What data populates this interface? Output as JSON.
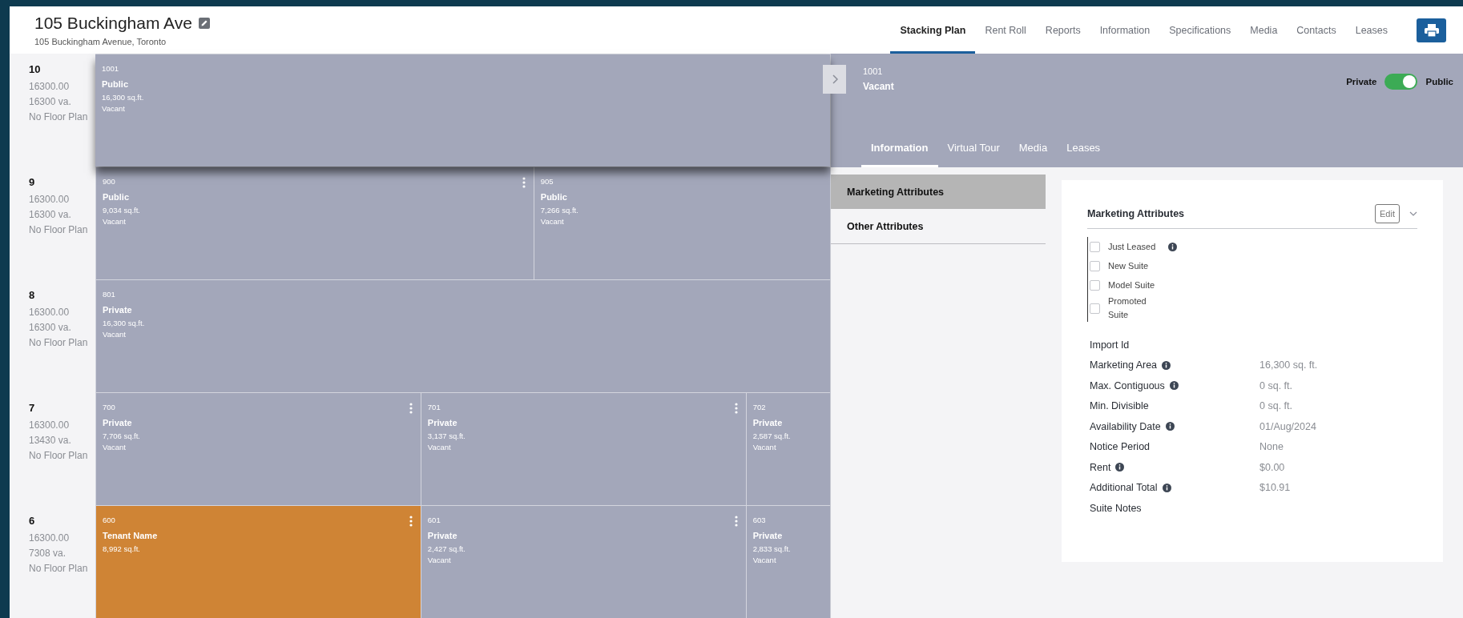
{
  "header": {
    "title": "105 Buckingham Ave",
    "address": "105 Buckingham Avenue, Toronto"
  },
  "nav": [
    {
      "label": "Stacking Plan",
      "selected": true
    },
    {
      "label": "Rent Roll",
      "selected": false
    },
    {
      "label": "Reports",
      "selected": false
    },
    {
      "label": "Information",
      "selected": false
    },
    {
      "label": "Specifications",
      "selected": false
    },
    {
      "label": "Media",
      "selected": false
    },
    {
      "label": "Contacts",
      "selected": false
    },
    {
      "label": "Leases",
      "selected": false
    }
  ],
  "floors": [
    {
      "number": "10",
      "area": "16300.00",
      "vacant_area": "16300 va.",
      "plan": "No Floor Plan",
      "suites": [
        {
          "number": "1001",
          "name": "Public",
          "area": "16,300 sq.ft.",
          "status": "Vacant",
          "color": "#a3a7ba",
          "menu": false,
          "selected": true
        }
      ]
    },
    {
      "number": "9",
      "area": "16300.00",
      "vacant_area": "16300 va.",
      "plan": "No Floor Plan",
      "suites": [
        {
          "number": "900",
          "name": "Public",
          "area": "9,034 sq.ft.",
          "status": "Vacant",
          "color": "#a3a7ba",
          "menu": true,
          "selected": false
        },
        {
          "number": "905",
          "name": "Public",
          "area": "7,266 sq.ft.",
          "status": "Vacant",
          "color": "#a3a7ba",
          "menu": false,
          "selected": false
        }
      ]
    },
    {
      "number": "8",
      "area": "16300.00",
      "vacant_area": "16300 va.",
      "plan": "No Floor Plan",
      "suites": [
        {
          "number": "801",
          "name": "Private",
          "area": "16,300 sq.ft.",
          "status": "Vacant",
          "color": "#a3a7ba",
          "menu": false,
          "selected": false
        }
      ]
    },
    {
      "number": "7",
      "area": "16300.00",
      "vacant_area": "13430 va.",
      "plan": "No Floor Plan",
      "suites": [
        {
          "number": "700",
          "name": "Private",
          "area": "7,706 sq.ft.",
          "status": "Vacant",
          "color": "#a3a7ba",
          "menu": true,
          "selected": false
        },
        {
          "number": "701",
          "name": "Private",
          "area": "3,137 sq.ft.",
          "status": "Vacant",
          "color": "#a3a7ba",
          "menu": true,
          "selected": false
        },
        {
          "number": "702",
          "name": "Private",
          "area": "2,587 sq.ft.",
          "status": "Vacant",
          "color": "#a3a7ba",
          "menu": false,
          "selected": false
        }
      ]
    },
    {
      "number": "6",
      "area": "16300.00",
      "vacant_area": "7308 va.",
      "plan": "No Floor Plan",
      "suites": [
        {
          "number": "600",
          "name": "Tenant Name",
          "area": "8,992 sq.ft.",
          "color": "#cf8435",
          "menu": true,
          "selected": false
        },
        {
          "number": "601",
          "name": "Private",
          "area": "2,427 sq.ft.",
          "status": "Vacant",
          "color": "#a3a7ba",
          "menu": true,
          "selected": false
        },
        {
          "number": "603",
          "name": "Private",
          "area": "2,833 sq.ft.",
          "status": "Vacant",
          "color": "#a3a7ba",
          "menu": false,
          "selected": false
        }
      ]
    }
  ],
  "detail": {
    "suite_number": "1001",
    "status": "Vacant",
    "visibility": {
      "left_label": "Private",
      "right_label": "Public",
      "on": true
    },
    "tabs": [
      {
        "label": "Information",
        "selected": true
      },
      {
        "label": "Virtual Tour",
        "selected": false
      },
      {
        "label": "Media",
        "selected": false
      },
      {
        "label": "Leases",
        "selected": false
      }
    ],
    "sections": [
      {
        "label": "Marketing Attributes",
        "selected": true
      },
      {
        "label": "Other Attributes",
        "selected": false
      }
    ],
    "card": {
      "title": "Marketing Attributes",
      "edit_label": "Edit",
      "checkboxes": [
        {
          "label": "Just Leased",
          "checked": false,
          "info": true
        },
        {
          "label": "New Suite",
          "checked": false,
          "info": false
        },
        {
          "label": "Model Suite",
          "checked": false,
          "info": false
        },
        {
          "label": "Promoted Suite",
          "checked": false,
          "info": false
        }
      ],
      "fields": [
        {
          "label": "Import Id",
          "info": false
        },
        {
          "label": "Marketing Area",
          "value": "16,300 sq. ft.",
          "info": true
        },
        {
          "label": "Max. Contiguous",
          "value": "0 sq. ft.",
          "info": true
        },
        {
          "label": "Min. Divisible",
          "value": "0 sq. ft.",
          "info": false
        },
        {
          "label": "Availability Date",
          "value": "01/Aug/2024",
          "info": true
        },
        {
          "label": "Notice Period",
          "value": "None",
          "info": false
        },
        {
          "label": "Rent",
          "value": "$0.00",
          "info": true
        },
        {
          "label": "Additional Total",
          "value": "$10.91",
          "info": true
        },
        {
          "label": "Suite Notes",
          "info": false
        }
      ]
    }
  }
}
